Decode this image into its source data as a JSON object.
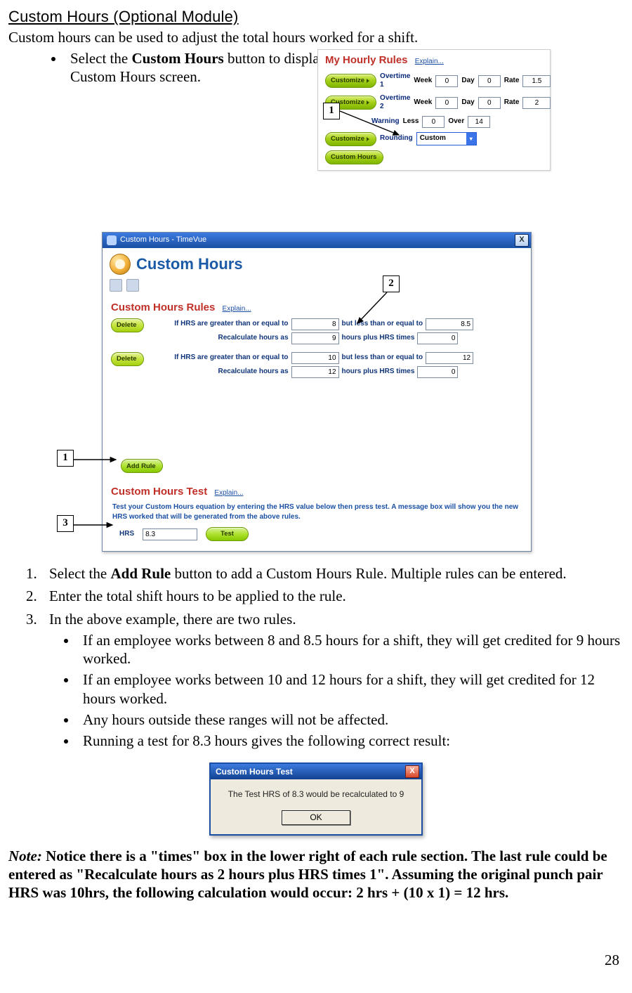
{
  "section_title": "Custom Hours (Optional Module)",
  "intro": "Custom hours can be used to adjust the total hours worked for a shift.",
  "top_bullet_pre": "Select the ",
  "top_bullet_bold": "Custom Hours",
  "top_bullet_post": " button to display the Custom Hours screen.",
  "callouts": {
    "c1a": "1",
    "c2": "2",
    "c1b": "1",
    "c3": "3"
  },
  "fig1": {
    "title": "My Hourly Rules",
    "explain": "Explain...",
    "customize": "Customize",
    "custom_hours_btn": "Custom Hours",
    "rows": {
      "ot1": {
        "label": "Overtime 1",
        "week_lbl": "Week",
        "week": "0",
        "day_lbl": "Day",
        "day": "0",
        "rate_lbl": "Rate",
        "rate": "1.5"
      },
      "ot2": {
        "label": "Overtime 2",
        "week_lbl": "Week",
        "week": "0",
        "day_lbl": "Day",
        "day": "0",
        "rate_lbl": "Rate",
        "rate": "2"
      },
      "warn": {
        "label": "Warning",
        "less_lbl": "Less",
        "less": "0",
        "over_lbl": "Over",
        "over": "14"
      },
      "round": {
        "label": "Rounding",
        "value": "Custom"
      }
    }
  },
  "fig2": {
    "titlebar": "Custom Hours - TimeVue",
    "close": "X",
    "heading": "Custom Hours",
    "rules_title": "Custom Hours Rules",
    "explain": "Explain...",
    "delete": "Delete",
    "labels": {
      "gte": "If HRS are greater than or equal to",
      "lte": "but less than or equal to",
      "recalc": "Recalculate hours as",
      "plus": "hours plus  HRS  times"
    },
    "rule1": {
      "gte": "8",
      "lte": "8.5",
      "recalc": "9",
      "times": "0"
    },
    "rule2": {
      "gte": "10",
      "lte": "12",
      "recalc": "12",
      "times": "0"
    },
    "add_rule": "Add Rule",
    "test_title": "Custom Hours Test",
    "test_desc": "Test your Custom Hours equation by entering the HRS value below then press test.  A message box will show you the new HRS worked that will be generated from the above rules.",
    "hrs_lbl": "HRS",
    "hrs_val": "8.3",
    "test_btn": "Test"
  },
  "steps": {
    "s1_pre": "Select the ",
    "s1_bold": "Add Rule",
    "s1_post": " button to add a Custom Hours Rule.  Multiple rules can be entered.",
    "s2": "Enter the total shift hours to be applied to the rule.",
    "s3": "In the above example, there are two rules.",
    "s3a": "If an employee works between 8 and 8.5 hours for a shift, they will get credited for 9 hours worked.",
    "s3b": "If an employee works between 10 and 12 hours for a shift, they will get credited for 12 hours worked.",
    "s3c": "Any hours outside these ranges will not be affected.",
    "s3d": "Running a test for 8.3 hours gives the following correct result:"
  },
  "fig3": {
    "title": "Custom Hours Test",
    "close": "X",
    "msg": "The Test HRS of 8.3 would be recalculated to 9",
    "ok": "OK"
  },
  "note": {
    "prefix": "Note:",
    "body": "  Notice there is a \"times\" box in the lower right of each rule section.  The last rule could be entered as \"Recalculate hours as 2 hours plus HRS times 1\".  Assuming the original punch pair HRS was 10hrs, the following calculation would occur:  2 hrs + (10 x 1) = 12 hrs."
  },
  "page": "28"
}
